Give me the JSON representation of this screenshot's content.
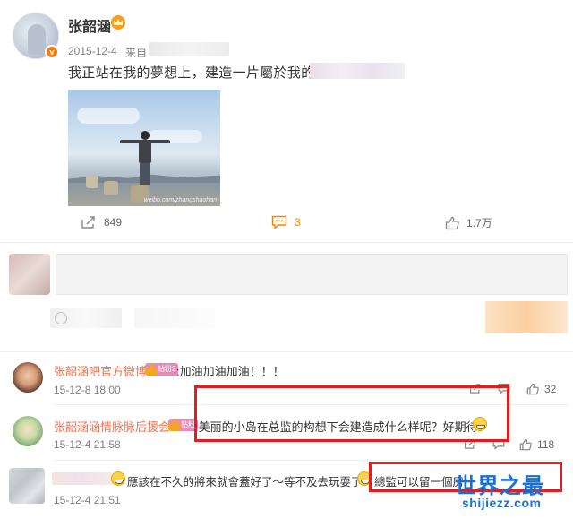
{
  "post": {
    "author": "张韶涵",
    "date": "2015-12-4",
    "source_prefix": "来自",
    "text": "我正站在我的夢想上，建造一片屬於我的海",
    "photo_watermark": "weibo.com/zhangshaohan"
  },
  "actions": {
    "share_count": "849",
    "comment_count": "3",
    "like_count": "1.7万"
  },
  "comments": [
    {
      "name": "张韶涵吧官方微博",
      "badge": "钻粉2",
      "text": ":加油加油加油！！！",
      "time": "15-12-8 18:00",
      "likes": "32"
    },
    {
      "name": "张韶涵涵情脉脉后援会",
      "badge": "钻粉",
      "text": ":美丽的小岛在总监的构想下会建造成什么样呢？好期待！",
      "time": "15-12-4 21:58",
      "likes": "118"
    },
    {
      "text_a": "應該在不久的將來就會蓋好了～等不及去玩耍了",
      "text_b": "總監可以留一個房",
      "time": "15-12-4 21:51"
    }
  ],
  "watermark": {
    "title": "世界之最",
    "url": "shijiezz.com"
  },
  "colors": {
    "accent_orange": "#ff8200",
    "name_color": "#eb7350",
    "highlight_red": "#e01e1e",
    "watermark_blue": "#1b6fd1"
  }
}
